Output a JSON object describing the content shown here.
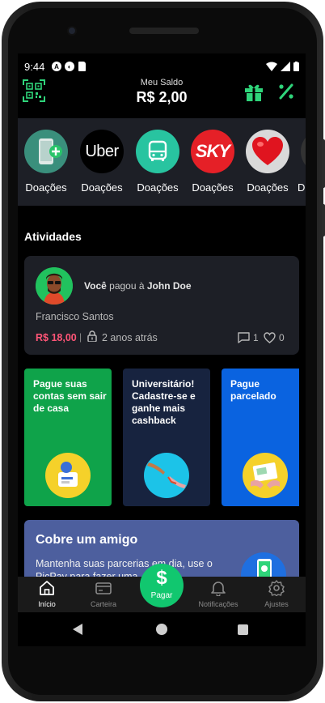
{
  "status_bar": {
    "time": "9:44"
  },
  "header": {
    "balance_label": "Meu Saldo",
    "balance_value": "R$ 2,00"
  },
  "carousel": {
    "items": [
      {
        "label": "Doações",
        "icon": "add-phone-icon"
      },
      {
        "label": "Doações",
        "logo_text": "Uber"
      },
      {
        "label": "Doações",
        "icon": "bus-icon"
      },
      {
        "label": "Doações",
        "logo_text": "SKY"
      },
      {
        "label": "Doações",
        "icon": "heart-icon"
      },
      {
        "label": "D"
      }
    ]
  },
  "activities": {
    "title": "Atividades",
    "item": {
      "actor": "Você",
      "action": "pagou à",
      "target": "John Doe",
      "name": "Francisco Santos",
      "amount": "R$ 18,00",
      "separator": "|",
      "time": "2 anos atrás",
      "comments": "1",
      "likes": "0"
    }
  },
  "promos": [
    {
      "text": "Pague suas contas sem sair de casa",
      "color": "#0fa34a"
    },
    {
      "text": "Universitário! Cadastre-se e ganhe mais cashback",
      "color": "#17233f"
    },
    {
      "text": "Pague parcelado",
      "color": "#0a63e0"
    }
  ],
  "cobre": {
    "title": "Cobre um amigo",
    "description": "Mantenha suas parcerias em dia, use o PicPay para fazer uma"
  },
  "navbar": {
    "items": [
      {
        "label": "Início",
        "active": true
      },
      {
        "label": "Carteira"
      },
      {
        "label": "Notificações"
      },
      {
        "label": "Ajustes"
      }
    ],
    "pay": {
      "symbol": "$",
      "label": "Pagar"
    }
  },
  "colors": {
    "accent": "#11c76f",
    "amount": "#ff5577",
    "card": "#1d1f26"
  }
}
